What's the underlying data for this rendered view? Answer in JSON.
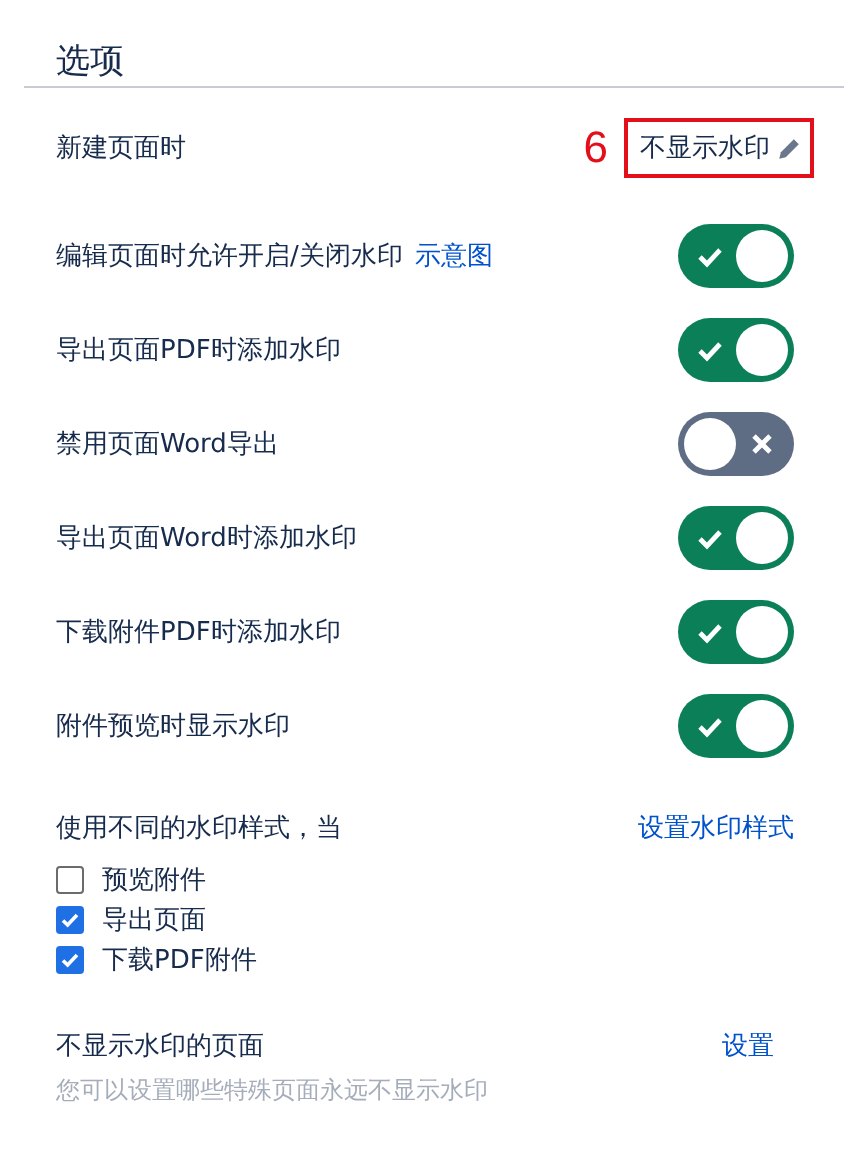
{
  "title": "选项",
  "rows": [
    {
      "kind": "select",
      "label": "新建页面时",
      "value": "不显示水印",
      "annotation": "6"
    },
    {
      "kind": "toggle",
      "label": "编辑页面时允许开启/关闭水印",
      "link": "示意图",
      "on": true
    },
    {
      "kind": "toggle",
      "label": "导出页面PDF时添加水印",
      "on": true
    },
    {
      "kind": "toggle",
      "label": "禁用页面Word导出",
      "on": false
    },
    {
      "kind": "toggle",
      "label": "导出页面Word时添加水印",
      "on": true
    },
    {
      "kind": "toggle",
      "label": "下载附件PDF时添加水印",
      "on": true
    },
    {
      "kind": "toggle",
      "label": "附件预览时显示水印",
      "on": true
    }
  ],
  "styles": {
    "label": "使用不同的水印样式，当",
    "link": "设置水印样式",
    "options": [
      {
        "label": "预览附件",
        "checked": false
      },
      {
        "label": "导出页面",
        "checked": true
      },
      {
        "label": "下载PDF附件",
        "checked": true
      }
    ]
  },
  "hidden_pages": {
    "label": "不显示水印的页面",
    "link": "设置",
    "hint": "您可以设置哪些特殊页面永远不显示水印"
  }
}
